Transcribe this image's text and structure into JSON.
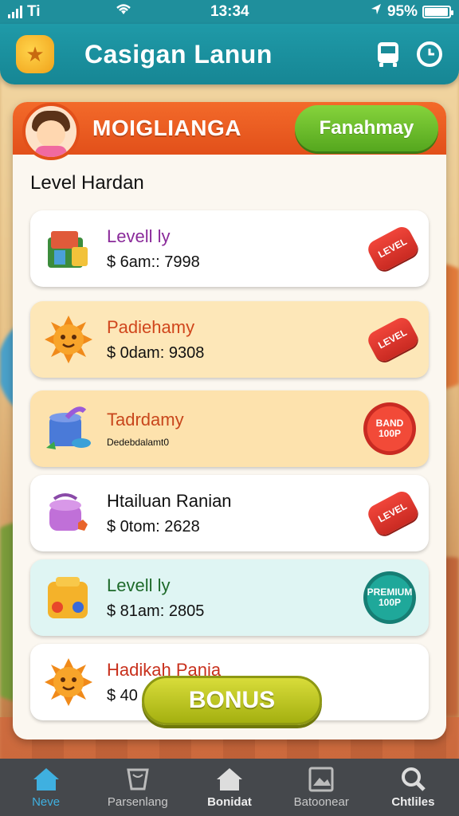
{
  "status_bar": {
    "carrier": "Ti",
    "time": "13:34",
    "battery": "95%",
    "battery_level": 0.95
  },
  "header": {
    "logo_icon": "star-badge-icon",
    "title": "Casigan Lanun",
    "icons": [
      "bus-icon",
      "clock-icon"
    ]
  },
  "banner": {
    "title": "MOIGLIANGA",
    "button_label": "Fanahmay"
  },
  "section": {
    "title": "Level Hardan"
  },
  "cards": [
    {
      "name": "Levell ly",
      "sub": "$ 6am:: 7998",
      "name_color": "#8a2a9a",
      "bg": "#ffffff",
      "icon": "toy-box-icon",
      "badge": "tag",
      "badge_text": "LEVEL"
    },
    {
      "name": "Padiehamy",
      "sub": "$ 0dam: 9308",
      "name_color": "#d0461c",
      "bg": "#fde7b8",
      "icon": "sun-icon",
      "badge": "tag",
      "badge_text": "LEVEL"
    },
    {
      "name": "Tadrdamy",
      "sub": "Dedebdalamt0",
      "name_color": "#c8461c",
      "bg": "#fde2ad",
      "icon": "paint-bucket-icon",
      "badge": "seal-red",
      "badge_text": "BAND 100P"
    },
    {
      "name": "Htailuan Ranian",
      "sub": "$ 0tom: 2628",
      "name_color": "#111111",
      "bg": "#ffffff",
      "icon": "pot-icon",
      "badge": "tag",
      "badge_text": "LEVEL"
    },
    {
      "name": "Levell ly",
      "sub": "$ 81am: 2805",
      "name_color": "#1e6a2a",
      "bg": "#dff5f3",
      "icon": "puzzle-box-icon",
      "badge": "seal-teal",
      "badge_text": "PREMIUM 100P"
    },
    {
      "name": "Hadikah Pania",
      "sub": "$ 40",
      "name_color": "#c8301c",
      "bg": "#ffffff",
      "icon": "sun-icon",
      "badge": "none",
      "badge_text": ""
    }
  ],
  "bonus_button": "BONUS",
  "bottom_nav": [
    {
      "label": "Neve",
      "icon": "home-icon"
    },
    {
      "label": "Parsenlang",
      "icon": "cup-icon"
    },
    {
      "label": "Bonidat",
      "icon": "house-icon"
    },
    {
      "label": "Batoonear",
      "icon": "image-icon"
    },
    {
      "label": "Chtliles",
      "icon": "search-icon"
    }
  ]
}
